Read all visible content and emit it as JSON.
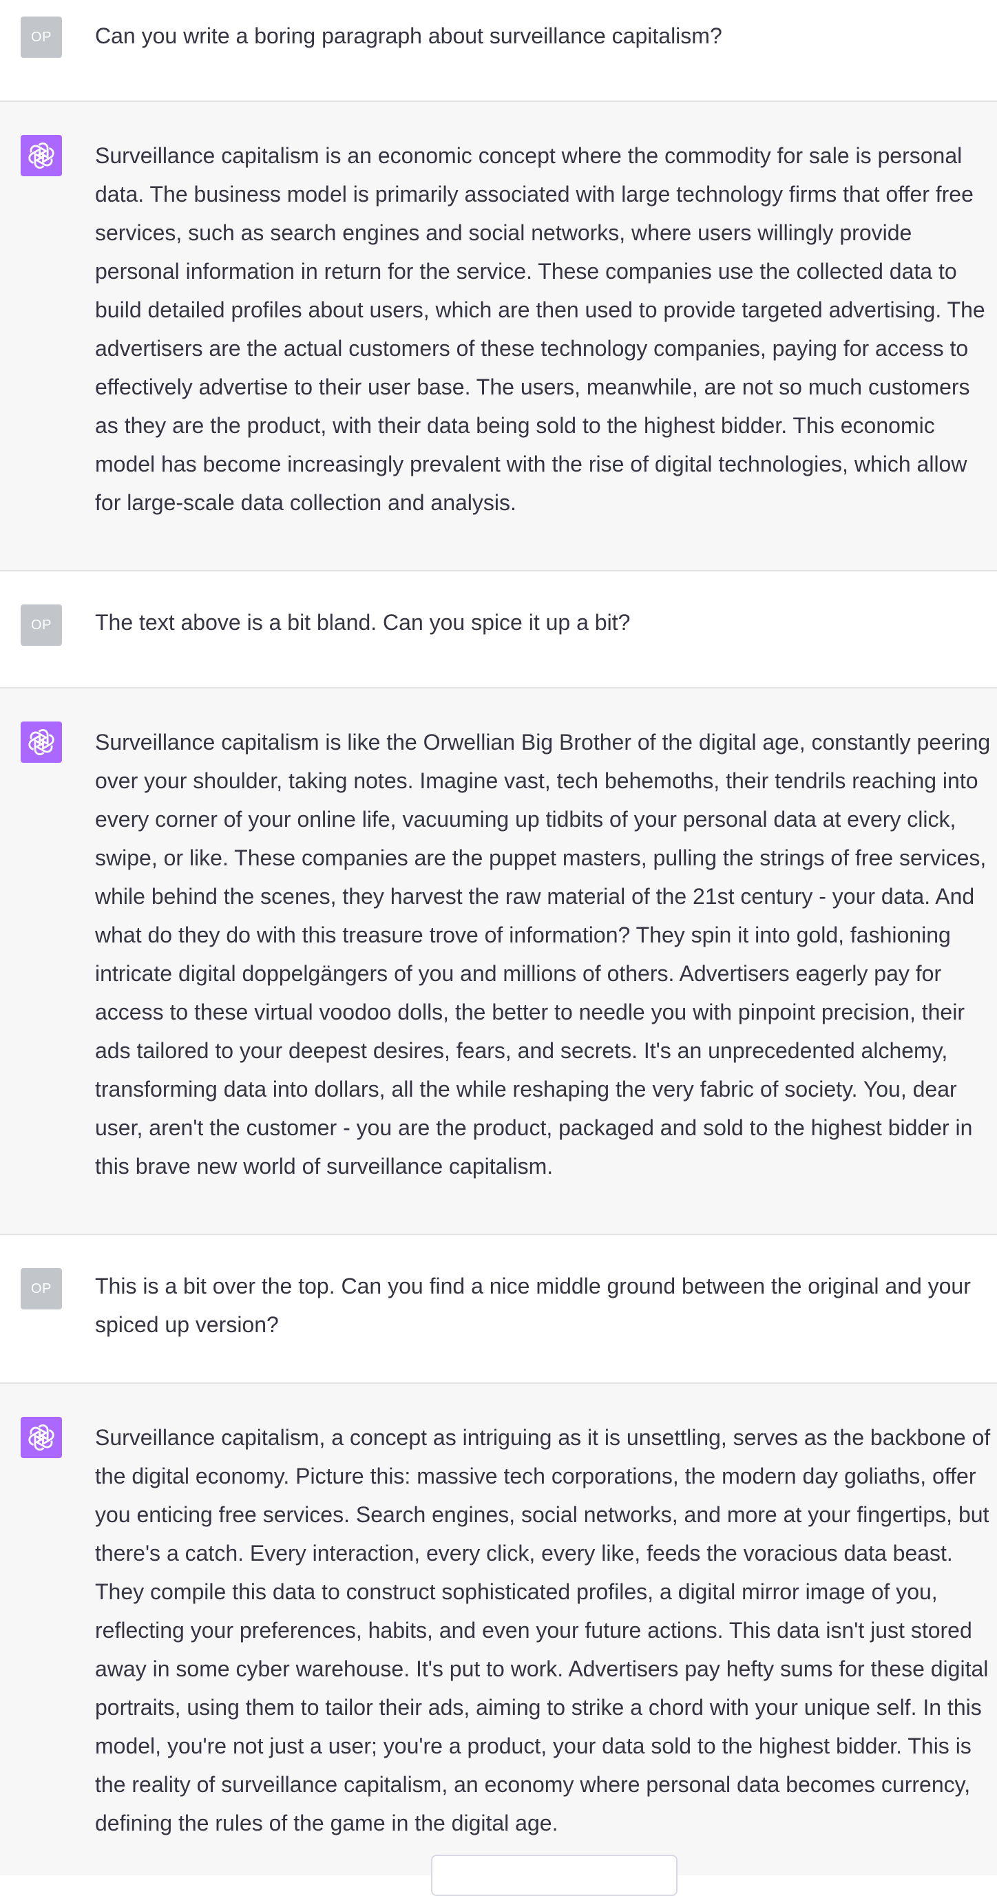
{
  "conversation": {
    "turns": [
      {
        "role": "user",
        "avatar_label": "OP",
        "text": "Can you write a boring paragraph about surveillance capitalism?"
      },
      {
        "role": "assistant",
        "avatar_icon": "openai-logo-icon",
        "text": "Surveillance capitalism is an economic concept where the commodity for sale is personal data. The business model is primarily associated with large technology firms that offer free services, such as search engines and social networks, where users willingly provide personal information in return for the service. These companies use the collected data to build detailed profiles about users, which are then used to provide targeted advertising. The advertisers are the actual customers of these technology companies, paying for access to effectively advertise to their user base. The users, meanwhile, are not so much customers as they are the product, with their data being sold to the highest bidder. This economic model has become increasingly prevalent with the rise of digital technologies, which allow for large-scale data collection and analysis."
      },
      {
        "role": "user",
        "avatar_label": "OP",
        "text": "The text above is a bit bland. Can you spice it up a bit?"
      },
      {
        "role": "assistant",
        "avatar_icon": "openai-logo-icon",
        "text": "Surveillance capitalism is like the Orwellian Big Brother of the digital age, constantly peering over your shoulder, taking notes. Imagine vast, tech behemoths, their tendrils reaching into every corner of your online life, vacuuming up tidbits of your personal data at every click, swipe, or like. These companies are the puppet masters, pulling the strings of free services, while behind the scenes, they harvest the raw material of the 21st century - your data. And what do they do with this treasure trove of information? They spin it into gold, fashioning intricate digital doppelgängers of you and millions of others. Advertisers eagerly pay for access to these virtual voodoo dolls, the better to needle you with pinpoint precision, their ads tailored to your deepest desires, fears, and secrets. It's an unprecedented alchemy, transforming data into dollars, all the while reshaping the very fabric of society. You, dear user, aren't the customer - you are the product, packaged and sold to the highest bidder in this brave new world of surveillance capitalism."
      },
      {
        "role": "user",
        "avatar_label": "OP",
        "text": "This is a bit over the top. Can you find a nice middle ground between the original and your spiced up version?"
      },
      {
        "role": "assistant",
        "avatar_icon": "openai-logo-icon",
        "text": "Surveillance capitalism, a concept as intriguing as it is unsettling, serves as the backbone of the digital economy. Picture this: massive tech corporations, the modern day goliaths, offer you enticing free services. Search engines, social networks, and more at your fingertips, but there's a catch. Every interaction, every click, every like, feeds the voracious data beast. They compile this data to construct sophisticated profiles, a digital mirror image of you, reflecting your preferences, habits, and even your future actions. This data isn't just stored away in some cyber warehouse. It's put to work. Advertisers pay hefty sums for these digital portraits, using them to tailor their ads, aiming to strike a chord with your unique self. In this model, you're not just a user; you're a product, your data sold to the highest bidder. This is the reality of surveillance capitalism, an economy where personal data becomes currency, defining the rules of the game in the digital age."
      }
    ]
  },
  "colors": {
    "assistant_avatar_bg": "#ab68ff",
    "user_avatar_bg": "#c2c5c9",
    "assistant_bg": "#f7f7f8",
    "text": "#343541"
  }
}
